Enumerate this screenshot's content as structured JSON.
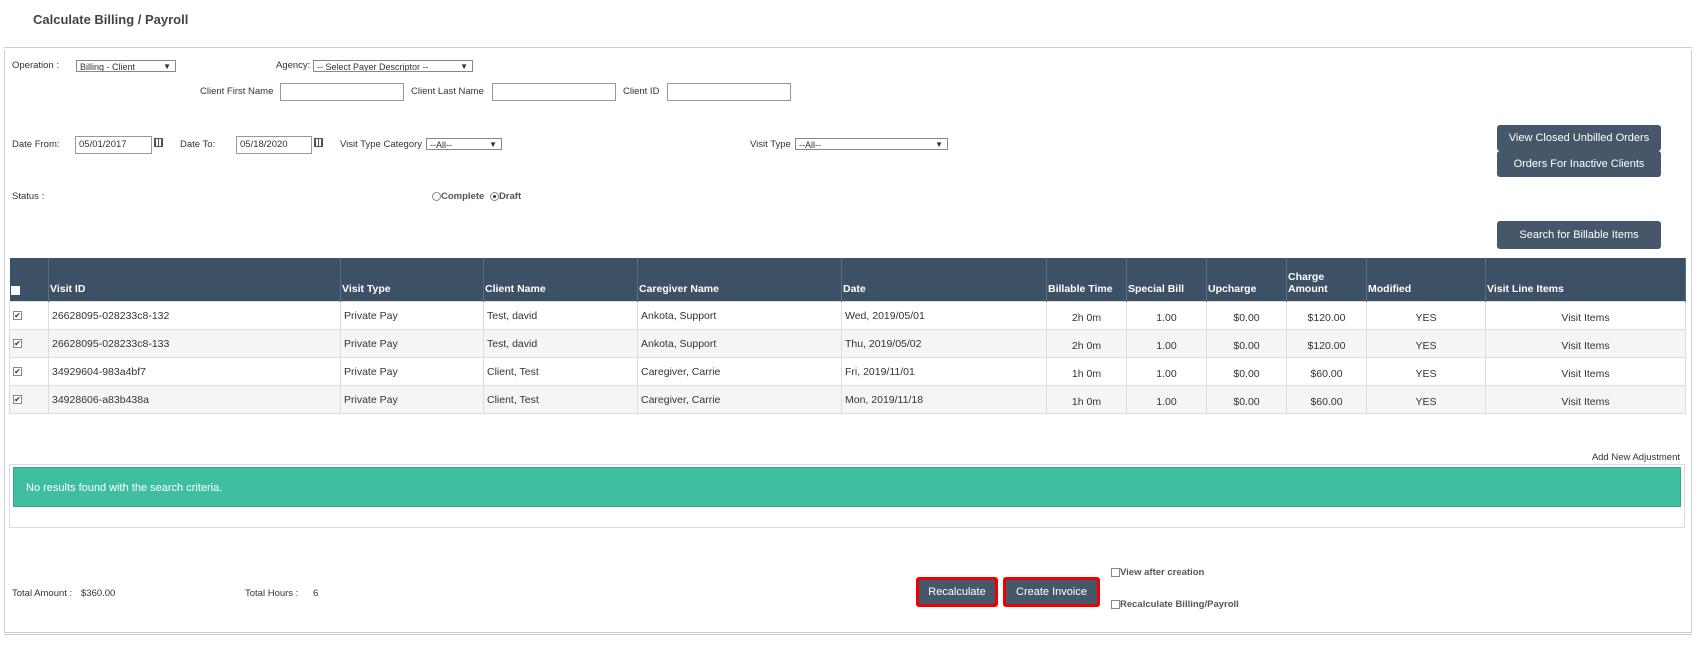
{
  "page_title": "Calculate Billing / Payroll",
  "filters": {
    "operation_label": "Operation :",
    "operation_value": "Billing - Client",
    "agency_label": "Agency:",
    "agency_value": "-- Select Payer Descriptor --",
    "client_first_label": "Client First Name",
    "client_last_label": "Client Last Name",
    "client_id_label": "Client ID",
    "date_from_label": "Date From:",
    "date_from_value": "05/01/2017",
    "date_to_label": "Date To:",
    "date_to_value": "05/18/2020",
    "visit_type_cat_label": "Visit Type Category",
    "visit_type_cat_value": "--All--",
    "visit_type_label": "Visit Type",
    "visit_type_value": "--All--",
    "status_label": "Status :",
    "status_complete": "Complete",
    "status_draft": "Draft",
    "status_selected": "Draft"
  },
  "buttons": {
    "view_closed": "View Closed Unbilled Orders",
    "inactive_clients": "Orders For Inactive Clients",
    "search": "Search for Billable Items",
    "recalculate": "Recalculate",
    "create_invoice": "Create Invoice"
  },
  "table": {
    "headers": [
      "Visit ID",
      "Visit Type",
      "Client Name",
      "Caregiver Name",
      "Date",
      "Billable Time",
      "Special Bill",
      "Upcharge",
      "Charge Amount",
      "Modified",
      "Visit Line Items"
    ],
    "rows": [
      {
        "checked": true,
        "visit_id": "26628095-028233c8-132",
        "visit_type": "Private Pay",
        "client": "Test, david",
        "caregiver": "Ankota, Support",
        "date": "Wed, 2019/05/01",
        "billable_time": "2h 0m",
        "special_bill": "1.00",
        "upcharge": "$0.00",
        "charge": "$120.00",
        "modified": "YES",
        "line_items": "Visit Items"
      },
      {
        "checked": true,
        "visit_id": "26628095-028233c8-133",
        "visit_type": "Private Pay",
        "client": "Test, david",
        "caregiver": "Ankota, Support",
        "date": "Thu, 2019/05/02",
        "billable_time": "2h 0m",
        "special_bill": "1.00",
        "upcharge": "$0.00",
        "charge": "$120.00",
        "modified": "YES",
        "line_items": "Visit Items"
      },
      {
        "checked": true,
        "visit_id": "34929604-983a4bf7",
        "visit_type": "Private Pay",
        "client": "Client, Test",
        "caregiver": "Caregiver, Carrie",
        "date": "Fri, 2019/11/01",
        "billable_time": "1h 0m",
        "special_bill": "1.00",
        "upcharge": "$0.00",
        "charge": "$60.00",
        "modified": "YES",
        "line_items": "Visit Items"
      },
      {
        "checked": true,
        "visit_id": "34928606-a83b438a",
        "visit_type": "Private Pay",
        "client": "Client, Test",
        "caregiver": "Caregiver, Carrie",
        "date": "Mon, 2019/11/18",
        "billable_time": "1h 0m",
        "special_bill": "1.00",
        "upcharge": "$0.00",
        "charge": "$60.00",
        "modified": "YES",
        "line_items": "Visit Items"
      }
    ]
  },
  "adjustment_link": "Add New Adjustment",
  "no_results_message": "No results found with the search criteria.",
  "totals": {
    "amount_label": "Total Amount :",
    "amount_value": "$360.00",
    "hours_label": "Total Hours :",
    "hours_value": "6"
  },
  "options": {
    "view_after_creation": "View after creation",
    "recalculate_billing": "Recalculate Billing/Payroll"
  },
  "colors": {
    "header_bg": "#3d5166",
    "button_bg": "#46576a",
    "success_bg": "#3fbfa0",
    "highlight_border": "#e00000"
  }
}
